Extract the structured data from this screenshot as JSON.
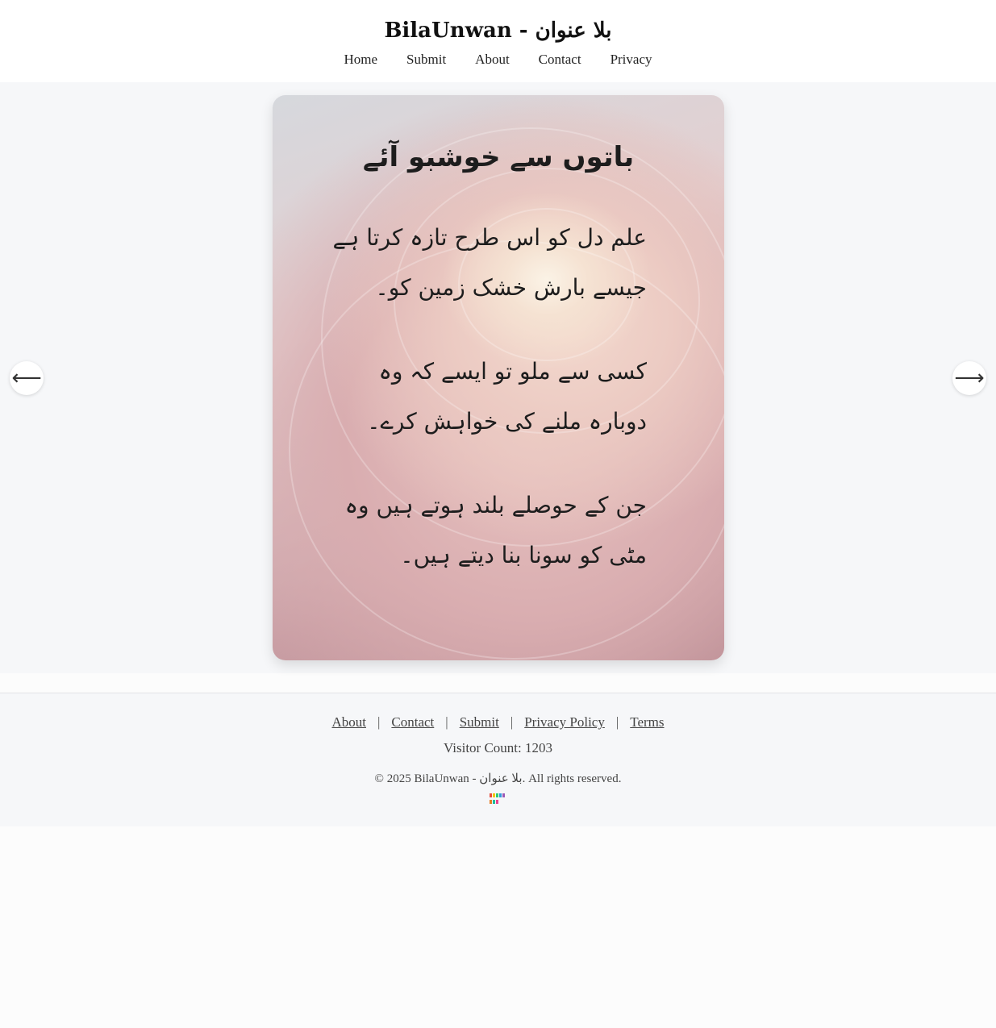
{
  "site": {
    "title": "BilaUnwan - بلا عنوان"
  },
  "nav": {
    "items": [
      {
        "label": "Home"
      },
      {
        "label": "Submit"
      },
      {
        "label": "About"
      },
      {
        "label": "Contact"
      },
      {
        "label": "Privacy"
      }
    ]
  },
  "slide": {
    "title": "باتوں سے خوشبو آئے",
    "lines": [
      "علم دل کو اس طرح تازہ کرتا ہے جیسے بارش خشک زمین کو۔",
      "کسی سے ملو تو ایسے کہ وہ دوبارہ ملنے کی خواہش کرے۔",
      "جن کے حوصلے بلند ہوتے ہیں وہ مٹی کو سونا بنا دیتے ہیں۔"
    ],
    "prev_icon": "left-arrow-icon",
    "next_icon": "right-arrow-icon",
    "prev_glyph": "⟵",
    "next_glyph": "⟶"
  },
  "footer": {
    "links": [
      {
        "label": "About"
      },
      {
        "label": "Contact"
      },
      {
        "label": "Submit"
      },
      {
        "label": "Privacy Policy"
      },
      {
        "label": "Terms"
      }
    ],
    "separator": "|",
    "visitor_count": "Visitor Count: 1203",
    "copyright": "© 2025 BilaUnwan - بلا عنوان. All rights reserved.",
    "badge_icon": "site-badge-icon"
  },
  "colors": {
    "header_bg": "#ffffff",
    "section_bg": "#f6f7f9",
    "text": "#222222"
  }
}
